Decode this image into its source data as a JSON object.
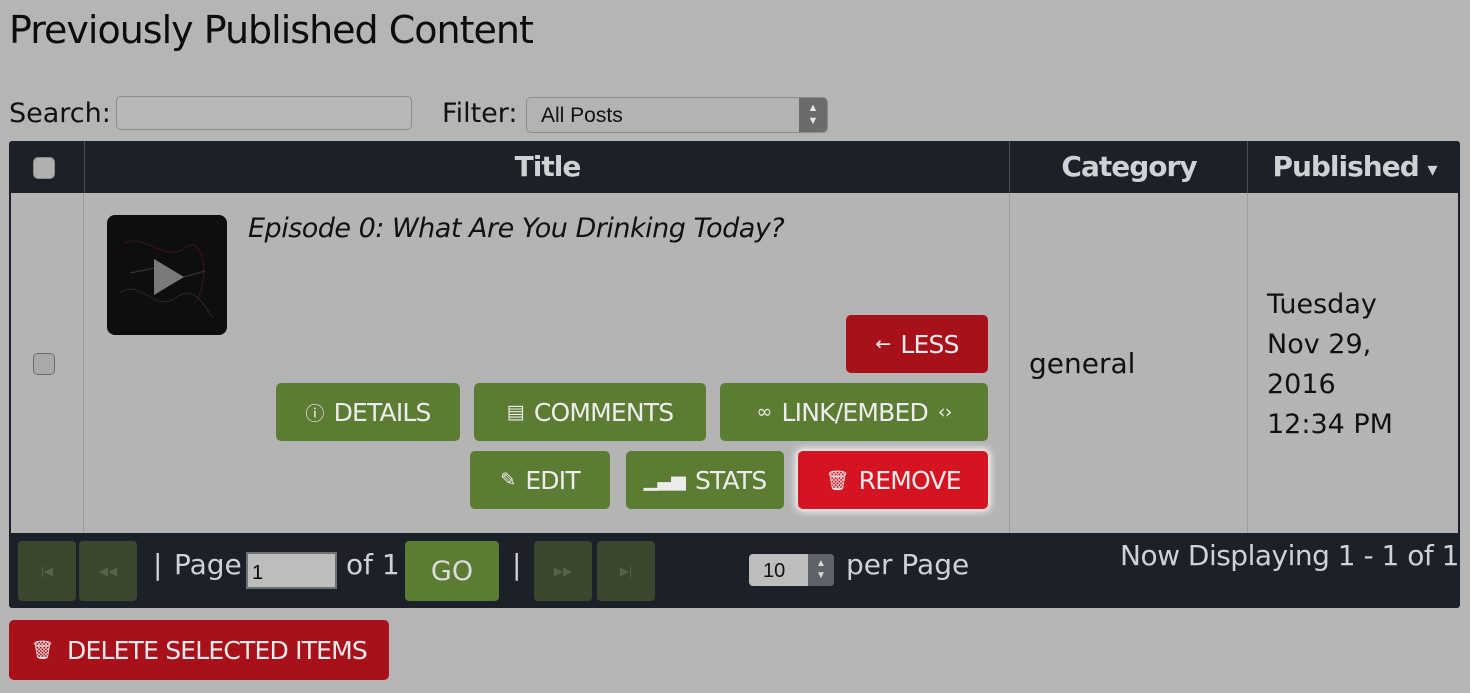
{
  "page": {
    "title": "Previously Published Content"
  },
  "toolbar": {
    "search_label": "Search:",
    "search_value": "",
    "filter_label": "Filter:",
    "filter_value": "All Posts"
  },
  "table": {
    "headers": {
      "title": "Title",
      "category": "Category",
      "published": "Published"
    },
    "sort_indicator": "▾",
    "rows": [
      {
        "title": "Episode 0: What Are You Drinking Today?",
        "category": "general",
        "published": [
          "Tuesday",
          "Nov 29,",
          "2016",
          "12:34 PM"
        ],
        "buttons": {
          "less": "LESS",
          "details": "DETAILS",
          "comments": "COMMENTS",
          "link_embed": "LINK/EMBED",
          "edit": "EDIT",
          "stats": "STATS",
          "remove": "REMOVE"
        }
      }
    ]
  },
  "pager": {
    "sep1": "|",
    "page_label": "Page",
    "page_value": "1",
    "of_label": "of 1",
    "go": "GO",
    "sep2": "|",
    "per_page_value": "10",
    "per_page_label": "per Page",
    "display_text": "Now Displaying 1 - 1 of 1"
  },
  "footer": {
    "delete_selected": "DELETE SELECTED ITEMS"
  },
  "colors": {
    "background": "#b5b5b5",
    "table_header": "#1c2029",
    "green_button": "#5c7c34",
    "red_button": "#a8101a",
    "remove_button": "#d51422"
  },
  "icons": {
    "less": "arrow-left-icon",
    "details": "info-icon",
    "comments": "comment-icon",
    "link_embed": "link-icon",
    "edit": "pencil-icon",
    "stats": "bar-chart-icon",
    "remove": "trash-icon",
    "delete_selected": "trash-icon"
  }
}
